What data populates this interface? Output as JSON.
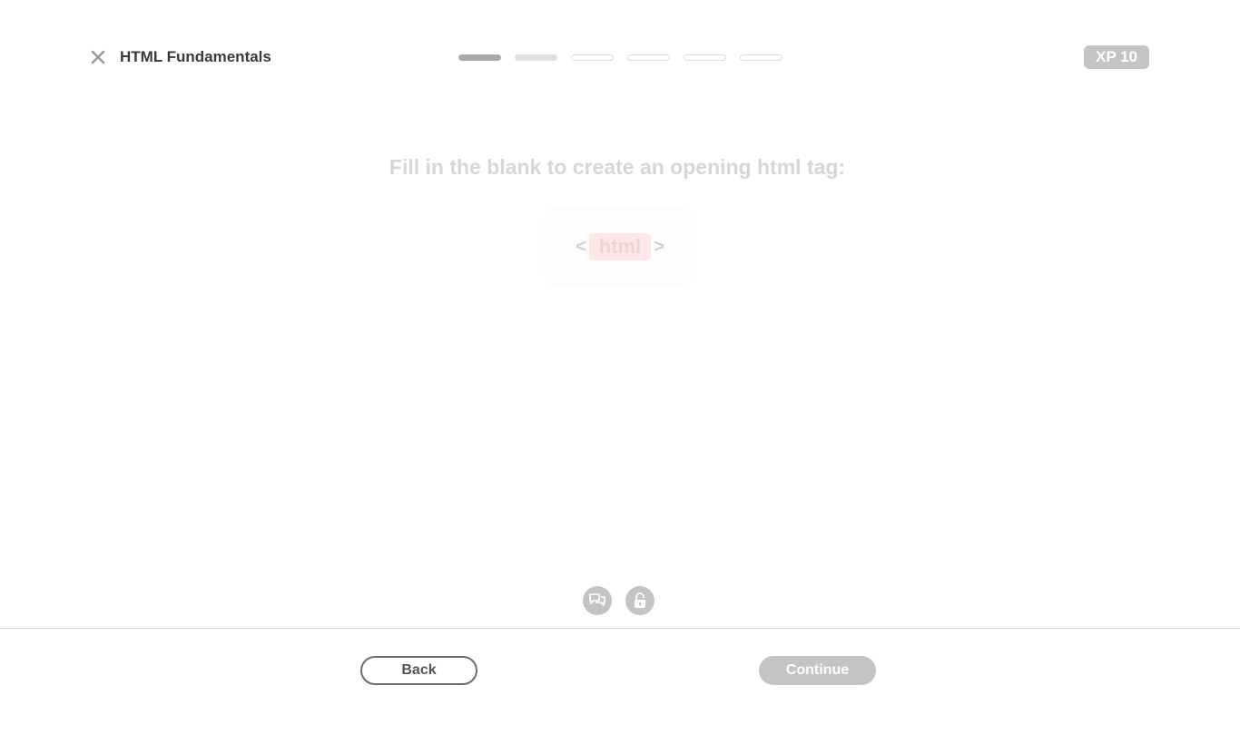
{
  "header": {
    "title": "HTML Fundamentals",
    "close_icon": "close-icon",
    "progress": {
      "total_steps": 6,
      "completed_steps": 1,
      "current_step": 2
    },
    "xp_label": "XP 10"
  },
  "lesson": {
    "prompt": "Fill in the blank to create an opening html tag:",
    "code": {
      "open_bracket": "<",
      "blank_answer": "html",
      "close_bracket": ">"
    }
  },
  "tools": {
    "comments_icon": "comments-icon",
    "unlock_icon": "unlock-icon"
  },
  "footer": {
    "back_label": "Back",
    "continue_label": "Continue"
  },
  "colors": {
    "accent_gray": "#c4c4c4",
    "blank_highlight": "#fde8e8",
    "text_dark": "#3a3a3a"
  }
}
